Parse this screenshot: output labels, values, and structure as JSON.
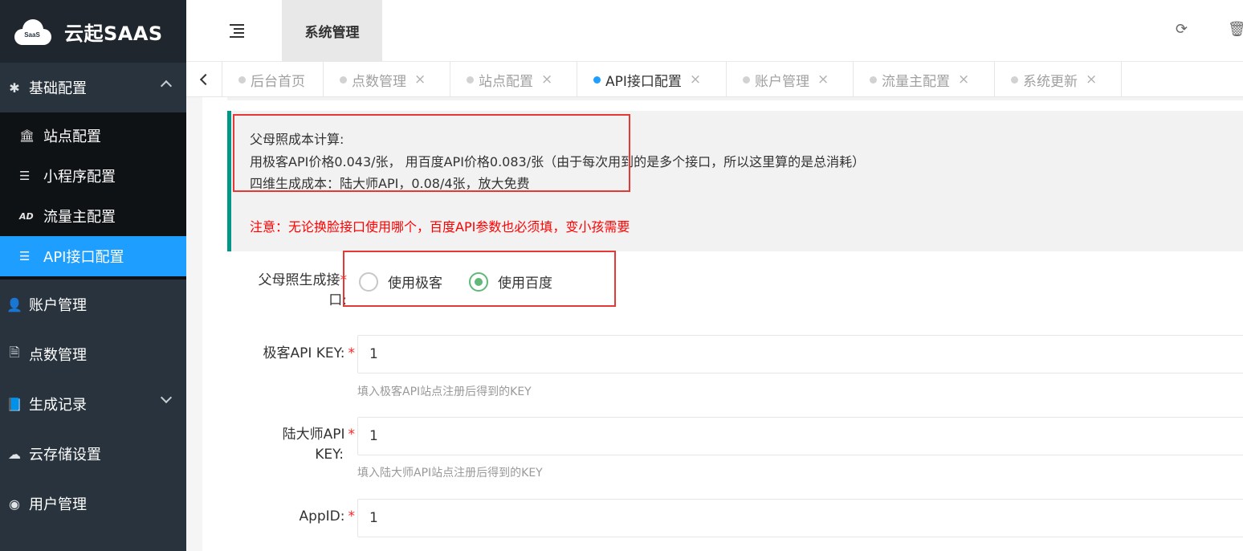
{
  "app": {
    "title": "云起SAAS",
    "logo_badge": "SaaS"
  },
  "sidebar": {
    "groups": [
      {
        "label": "基础配置",
        "icon": "asterisk-icon",
        "expanded": true
      },
      {
        "label": "账户管理",
        "icon": "user-add-icon"
      },
      {
        "label": "点数管理",
        "icon": "document-points-icon"
      },
      {
        "label": "生成记录",
        "icon": "book-icon",
        "collapsible": true
      },
      {
        "label": "云存储设置",
        "icon": "cloud-icon"
      },
      {
        "label": "用户管理",
        "icon": "user-circle-icon"
      }
    ],
    "sub_items": [
      {
        "label": "站点配置",
        "icon": "bank-icon"
      },
      {
        "label": "小程序配置",
        "icon": "list-icon"
      },
      {
        "label": "流量主配置",
        "icon": "ad-icon"
      },
      {
        "label": "API接口配置",
        "icon": "list-icon",
        "active": true
      }
    ]
  },
  "header": {
    "active_tab": "系统管理"
  },
  "tabs": [
    {
      "label": "后台首页",
      "closable": false
    },
    {
      "label": "点数管理",
      "closable": true
    },
    {
      "label": "站点配置",
      "closable": true
    },
    {
      "label": "API接口配置",
      "closable": true,
      "active": true
    },
    {
      "label": "账户管理",
      "closable": true
    },
    {
      "label": "流量主配置",
      "closable": true
    },
    {
      "label": "系统更新",
      "closable": true
    }
  ],
  "tab_close_glyph": "×",
  "notice": {
    "line1": "父母照成本计算:",
    "line2": "用极客API价格0.043/张， 用百度API价格0.083/张（由于每次用到的是多个接口，所以这里算的是总消耗）",
    "line3": "四维生成成本：陆大师API，0.08/4张，放大免费",
    "warning": "注意：无论换脸接口使用哪个，百度API参数也必须填，变小孩需要"
  },
  "form": {
    "interface": {
      "label_line1": "父母照生成接",
      "label_line2": "口:",
      "required_mark": "*",
      "options": [
        "使用极客",
        "使用百度"
      ],
      "selected": "使用百度"
    },
    "geek_key": {
      "label": "极客API KEY:",
      "required_mark": "*",
      "value": "1",
      "help": "填入极客API站点注册后得到的KEY"
    },
    "lu_key": {
      "label_line1": "陆大师API",
      "label_line2": "KEY:",
      "required_mark": "*",
      "value": "1",
      "help": "填入陆大师API站点注册后得到的KEY"
    },
    "appid": {
      "label": "AppID:",
      "required_mark": "*",
      "value": "1"
    }
  },
  "colors": {
    "sidebar_bg": "#28333e",
    "active": "#1e9fff",
    "notice_border": "#009688",
    "warning": "#ff0000",
    "radio_checked": "#5fb878",
    "highlight_box": "#e53935"
  }
}
